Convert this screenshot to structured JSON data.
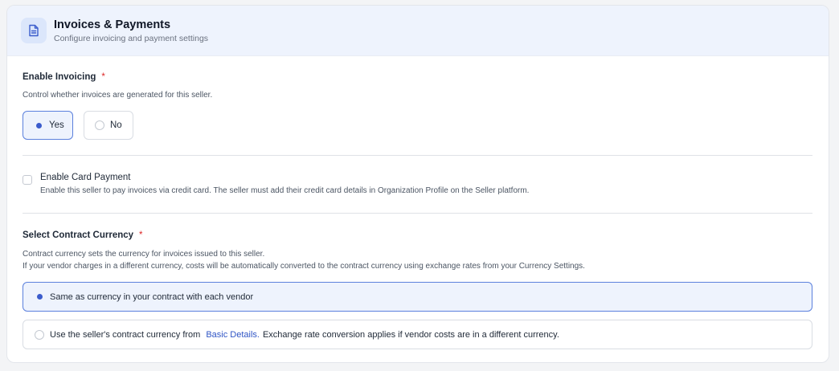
{
  "header": {
    "title": "Invoices & Payments",
    "subtitle": "Configure invoicing and payment settings",
    "icon": "document-icon"
  },
  "invoicing": {
    "label": "Enable Invoicing",
    "required_mark": "*",
    "help": "Control whether invoices are generated for this seller.",
    "options": [
      {
        "label": "Yes",
        "selected": true
      },
      {
        "label": "No",
        "selected": false
      }
    ]
  },
  "card_payment": {
    "label": "Enable Card Payment",
    "checked": false,
    "help": "Enable this seller to pay invoices via credit card. The seller must add their credit card details in Organization Profile on the Seller platform."
  },
  "currency": {
    "label": "Select Contract Currency",
    "required_mark": "*",
    "help_line1": "Contract currency sets the currency for invoices issued to this seller.",
    "help_line2": "If your vendor charges in a different currency, costs will be automatically converted to the contract currency using exchange rates from your Currency Settings.",
    "option1": {
      "label": "Same as currency in your contract with each vendor",
      "selected": true
    },
    "option2": {
      "prefix": "Use the seller's contract currency from",
      "link": "Basic Details.",
      "suffix": "Exchange rate conversion applies if vendor costs are in a different currency.",
      "selected": false
    }
  },
  "colors": {
    "accent": "#3b5ccc",
    "selected_bg": "#eef3fd",
    "required": "#dc2626",
    "link": "#2f55c5"
  }
}
